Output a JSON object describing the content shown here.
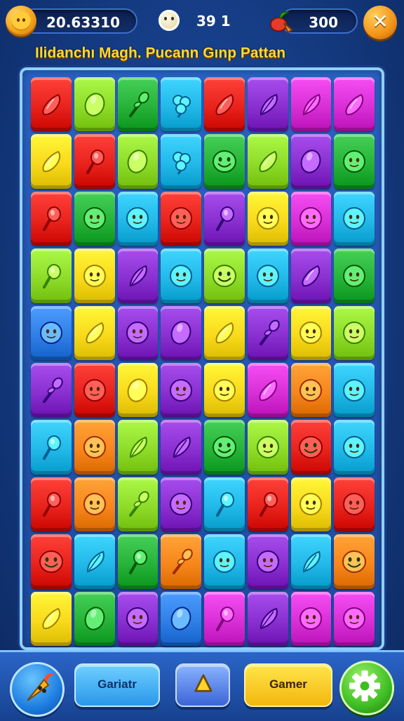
{
  "hud": {
    "score": "20.63310",
    "moves": "39 1",
    "fruit_count": "300",
    "close_symbol": "✕",
    "coin_icon": "coin-face-icon",
    "moves_icon": "skull-icon",
    "fruit_icon": "fruit-icon"
  },
  "title": "Ilidanchı Magh. Pucann Gınp Pattan",
  "palette": {
    "R": "#e8231c",
    "O": "#f7861b",
    "Y": "#f9d91b",
    "L": "#8fdb2a",
    "G": "#27b33a",
    "C": "#22b8e8",
    "B": "#2f7fe6",
    "P": "#8a2fd0",
    "M": "#d92fd6"
  },
  "board": {
    "columns": 8,
    "rows": [
      [
        {
          "c": "R",
          "s": "drop"
        },
        {
          "c": "L",
          "s": "bean"
        },
        {
          "c": "G",
          "s": "sprout"
        },
        {
          "c": "C",
          "s": "cluster"
        },
        {
          "c": "R",
          "s": "drop"
        },
        {
          "c": "P",
          "s": "leaf"
        },
        {
          "c": "M",
          "s": "leaf"
        },
        {
          "c": "M",
          "s": "drop"
        }
      ],
      [
        {
          "c": "Y",
          "s": "drop"
        },
        {
          "c": "R",
          "s": "spoon"
        },
        {
          "c": "L",
          "s": "bean"
        },
        {
          "c": "C",
          "s": "cluster"
        },
        {
          "c": "G",
          "s": "smile"
        },
        {
          "c": "L",
          "s": "drop"
        },
        {
          "c": "P",
          "s": "bean"
        },
        {
          "c": "G",
          "s": "face"
        }
      ],
      [
        {
          "c": "R",
          "s": "spoon"
        },
        {
          "c": "G",
          "s": "face"
        },
        {
          "c": "C",
          "s": "face"
        },
        {
          "c": "R",
          "s": "face"
        },
        {
          "c": "P",
          "s": "spoon"
        },
        {
          "c": "Y",
          "s": "face"
        },
        {
          "c": "M",
          "s": "face"
        },
        {
          "c": "C",
          "s": "face"
        }
      ],
      [
        {
          "c": "L",
          "s": "spoon"
        },
        {
          "c": "Y",
          "s": "face"
        },
        {
          "c": "P",
          "s": "leaf"
        },
        {
          "c": "C",
          "s": "face"
        },
        {
          "c": "L",
          "s": "smile"
        },
        {
          "c": "C",
          "s": "face"
        },
        {
          "c": "P",
          "s": "drop"
        },
        {
          "c": "G",
          "s": "face"
        }
      ],
      [
        {
          "c": "B",
          "s": "face"
        },
        {
          "c": "Y",
          "s": "drop"
        },
        {
          "c": "P",
          "s": "face"
        },
        {
          "c": "P",
          "s": "bean"
        },
        {
          "c": "Y",
          "s": "drop"
        },
        {
          "c": "P",
          "s": "sprout"
        },
        {
          "c": "Y",
          "s": "face"
        },
        {
          "c": "L",
          "s": "face"
        }
      ],
      [
        {
          "c": "P",
          "s": "sprout"
        },
        {
          "c": "R",
          "s": "face"
        },
        {
          "c": "Y",
          "s": "bean"
        },
        {
          "c": "P",
          "s": "face"
        },
        {
          "c": "Y",
          "s": "face"
        },
        {
          "c": "M",
          "s": "drop"
        },
        {
          "c": "O",
          "s": "face"
        },
        {
          "c": "C",
          "s": "face"
        }
      ],
      [
        {
          "c": "C",
          "s": "spoon"
        },
        {
          "c": "O",
          "s": "face"
        },
        {
          "c": "L",
          "s": "leaf"
        },
        {
          "c": "P",
          "s": "leaf"
        },
        {
          "c": "G",
          "s": "smile"
        },
        {
          "c": "L",
          "s": "face"
        },
        {
          "c": "R",
          "s": "smile"
        },
        {
          "c": "C",
          "s": "face"
        }
      ],
      [
        {
          "c": "R",
          "s": "spoon"
        },
        {
          "c": "O",
          "s": "face"
        },
        {
          "c": "L",
          "s": "sprout"
        },
        {
          "c": "P",
          "s": "face"
        },
        {
          "c": "C",
          "s": "spoon"
        },
        {
          "c": "R",
          "s": "spoon"
        },
        {
          "c": "Y",
          "s": "face"
        },
        {
          "c": "R",
          "s": "face"
        }
      ],
      [
        {
          "c": "R",
          "s": "smile"
        },
        {
          "c": "C",
          "s": "leaf"
        },
        {
          "c": "G",
          "s": "spoon"
        },
        {
          "c": "O",
          "s": "sprout"
        },
        {
          "c": "C",
          "s": "face"
        },
        {
          "c": "P",
          "s": "face"
        },
        {
          "c": "C",
          "s": "leaf"
        },
        {
          "c": "O",
          "s": "smile"
        }
      ],
      [
        {
          "c": "Y",
          "s": "drop"
        },
        {
          "c": "G",
          "s": "bean"
        },
        {
          "c": "P",
          "s": "face"
        },
        {
          "c": "B",
          "s": "bean"
        },
        {
          "c": "M",
          "s": "spoon"
        },
        {
          "c": "P",
          "s": "leaf"
        },
        {
          "c": "M",
          "s": "face"
        },
        {
          "c": "M",
          "s": "face"
        }
      ]
    ]
  },
  "bottom": {
    "left_icon": "carrot-character-icon",
    "garden_label": "Gariatr",
    "play_icon": "play-triangle-icon",
    "gamer_label": "Gamer",
    "settings_icon": "gear-icon"
  }
}
